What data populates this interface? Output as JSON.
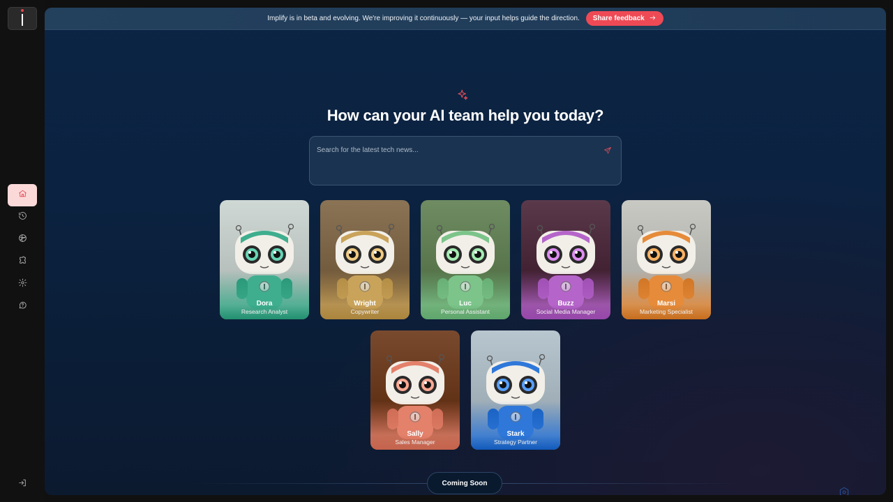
{
  "banner": {
    "text": "Implify is in beta and evolving. We're improving it continuously — your input helps guide the direction.",
    "button_label": "Share feedback"
  },
  "sidebar": {
    "items": [
      {
        "icon": "home-icon",
        "active": true
      },
      {
        "icon": "history-icon",
        "active": false
      },
      {
        "icon": "globe-icon",
        "active": false
      },
      {
        "icon": "puzzle-icon",
        "active": false
      },
      {
        "icon": "gear-icon",
        "active": false
      },
      {
        "icon": "help-chat-icon",
        "active": false
      }
    ],
    "bottom_icon": "logout-icon"
  },
  "main": {
    "headline": "How can your AI team help you today?",
    "search_placeholder": "Search for the latest tech news..."
  },
  "agents": [
    {
      "name": "Dora",
      "role": "Research Analyst",
      "color": "#3fae8e"
    },
    {
      "name": "Wright",
      "role": "Copywriter",
      "color": "#c9a35a"
    },
    {
      "name": "Luc",
      "role": "Personal Assistant",
      "color": "#7cc48a"
    },
    {
      "name": "Buzz",
      "role": "Social Media Manager",
      "color": "#b565c9"
    },
    {
      "name": "Marsi",
      "role": "Marketing Specialist",
      "color": "#e58b3a"
    },
    {
      "name": "Sally",
      "role": "Sales Manager",
      "color": "#e3816b"
    },
    {
      "name": "Stark",
      "role": "Strategy Partner",
      "color": "#2f78d9"
    }
  ],
  "coming_soon": "Coming Soon",
  "colors": {
    "accent": "#ee4a55",
    "active_nav_bg": "#fcd9d9"
  }
}
